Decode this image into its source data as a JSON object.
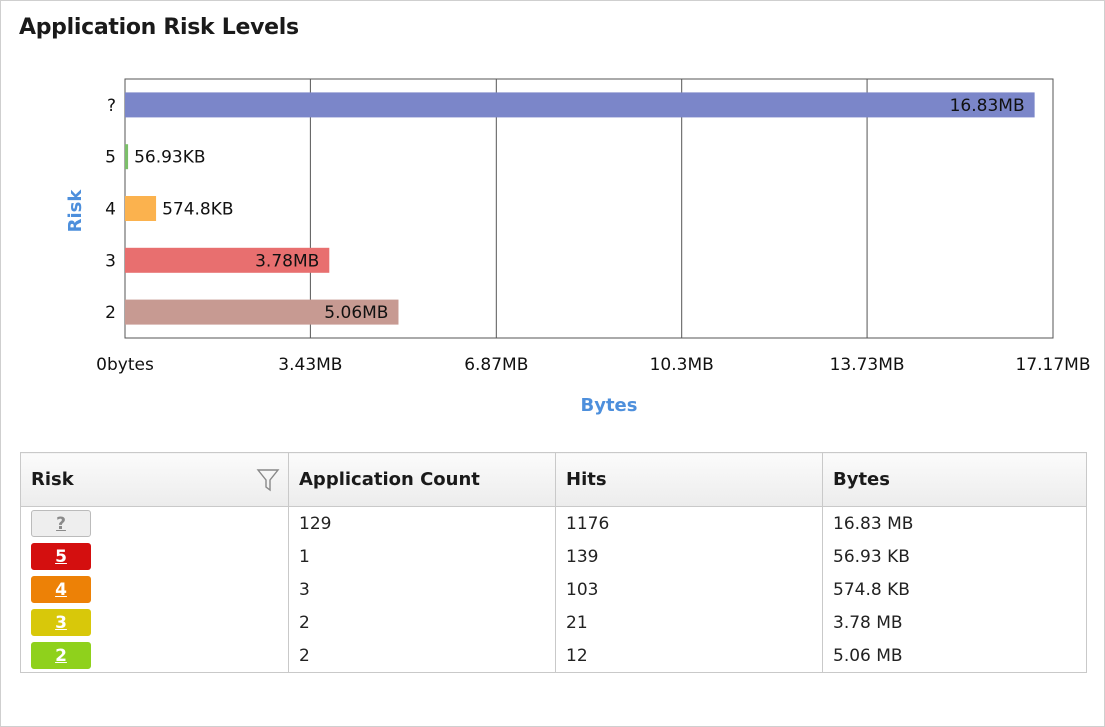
{
  "panel": {
    "title": "Application Risk Levels"
  },
  "chart_data": {
    "type": "bar",
    "orientation": "horizontal",
    "title": "Application Risk Levels",
    "xlabel": "Bytes",
    "ylabel": "Risk",
    "categories": [
      "?",
      "5",
      "4",
      "3",
      "2"
    ],
    "values": [
      16.83,
      0.05693,
      0.5748,
      3.78,
      5.06
    ],
    "value_units": "MB",
    "data_labels": [
      "16.83MB",
      "56.93KB",
      "574.8KB",
      "3.78MB",
      "5.06MB"
    ],
    "colors": [
      "#7b86c9",
      "#7cbf6a",
      "#fbb24e",
      "#e86f6f",
      "#c79a92"
    ],
    "xlim": [
      0,
      17.17
    ],
    "x_ticks": [
      0,
      3.43,
      6.87,
      10.3,
      13.73,
      17.17
    ],
    "x_tick_labels": [
      "0bytes",
      "3.43MB",
      "6.87MB",
      "10.3MB",
      "13.73MB",
      "17.17MB"
    ],
    "grid": "vertical"
  },
  "table": {
    "headers": {
      "risk": "Risk",
      "app_count": "Application Count",
      "hits": "Hits",
      "bytes": "Bytes"
    },
    "rows": [
      {
        "risk": "?",
        "badge_bg": "#eeeeee",
        "badge_fg": "#8a8a8a",
        "badge_border": "#bbbbbb",
        "app_count": "129",
        "hits": "1176",
        "bytes": "16.83 MB"
      },
      {
        "risk": "5",
        "badge_bg": "#d40f0f",
        "badge_fg": "#ffffff",
        "badge_border": "#d40f0f",
        "app_count": "1",
        "hits": "139",
        "bytes": "56.93 KB"
      },
      {
        "risk": "4",
        "badge_bg": "#ed8106",
        "badge_fg": "#ffffff",
        "badge_border": "#ed8106",
        "app_count": "3",
        "hits": "103",
        "bytes": "574.8 KB"
      },
      {
        "risk": "3",
        "badge_bg": "#d8c80a",
        "badge_fg": "#ffffff",
        "badge_border": "#d8c80a",
        "app_count": "2",
        "hits": "21",
        "bytes": "3.78 MB"
      },
      {
        "risk": "2",
        "badge_bg": "#8fd11c",
        "badge_fg": "#ffffff",
        "badge_border": "#8fd11c",
        "app_count": "2",
        "hits": "12",
        "bytes": "5.06 MB"
      }
    ]
  },
  "icons": {
    "filter": "filter-icon"
  }
}
